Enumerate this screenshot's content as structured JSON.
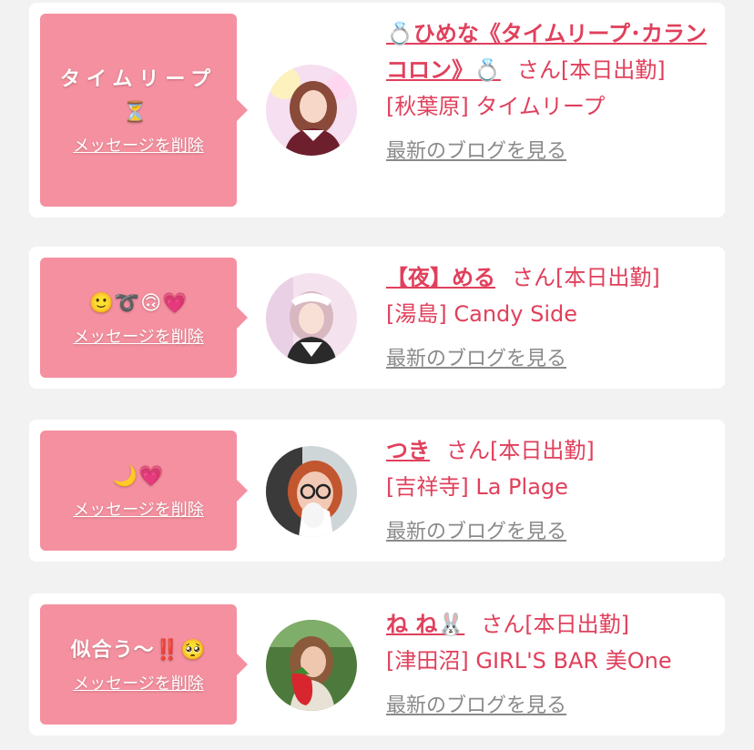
{
  "entries": [
    {
      "message": "タイムリープ⏳",
      "delete_label": "メッセージを削除",
      "name": "💍ひめな《タイムリープ･カランコロン》💍",
      "san": "さん",
      "status": "[本日出勤]",
      "store": "[秋葉原] タイムリープ",
      "blog_label": "最新のブログを見る"
    },
    {
      "message": "🙂➰🙃💗",
      "delete_label": "メッセージを削除",
      "name": "【夜】める",
      "san": "さん",
      "status": "[本日出勤]",
      "store": "[湯島] Candy Side",
      "blog_label": "最新のブログを見る"
    },
    {
      "message": "🌙💗",
      "delete_label": "メッセージを削除",
      "name": "つき",
      "san": "さん",
      "status": "[本日出勤]",
      "store": "[吉祥寺] La Plage",
      "blog_label": "最新のブログを見る"
    },
    {
      "message": "似合う〜‼️🥺",
      "delete_label": "メッセージを削除",
      "name": "ね ね🐰",
      "san": "さん",
      "status": "[本日出勤]",
      "store": "[津田沼] GIRL'S BAR 美One",
      "blog_label": "最新のブログを見る"
    }
  ],
  "colors": {
    "accent": "#e0405c",
    "bubble": "#f4909f",
    "link_gray": "#8a8a8a",
    "background": "#f2f2f2"
  }
}
